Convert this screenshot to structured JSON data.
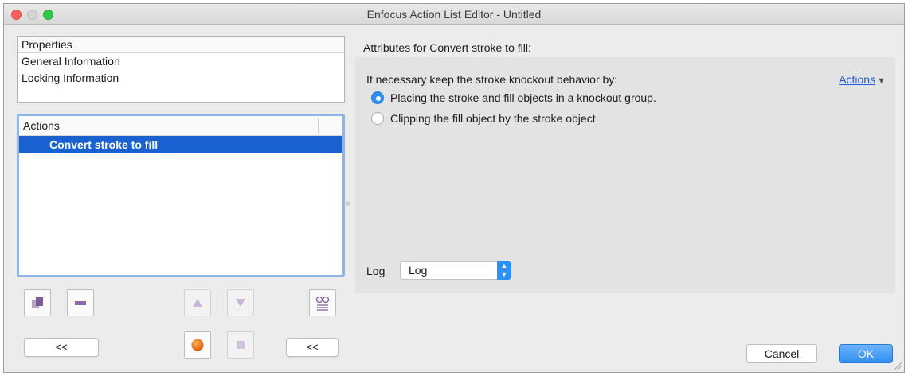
{
  "window": {
    "title": "Enfocus Action List Editor - Untitled"
  },
  "properties": {
    "header": "Properties",
    "items": [
      "General Information",
      "Locking Information"
    ]
  },
  "actions_list": {
    "header": "Actions",
    "items": [
      {
        "label": "Convert stroke to fill",
        "selected": true
      }
    ]
  },
  "toolbar": {
    "add_icon": "add-action-icon",
    "remove_icon": "remove-action-icon",
    "move_up_icon": "arrow-up-icon",
    "move_down_icon": "arrow-down-icon",
    "preview_icon": "glasses-icon",
    "record_icon": "record-icon",
    "stop_icon": "stop-icon",
    "collapse_left_label": "<<",
    "collapse_right_label": "<<"
  },
  "attributes": {
    "title": "Attributes for Convert stroke to fill:",
    "keep_label": "If necessary keep the stroke knockout behavior by:",
    "actions_link": "Actions",
    "options": [
      {
        "label": "Placing the stroke and fill objects in a knockout group.",
        "selected": true
      },
      {
        "label": "Clipping the fill object by the stroke object.",
        "selected": false
      }
    ],
    "log_label": "Log",
    "log_value": "Log"
  },
  "footer": {
    "cancel_label": "Cancel",
    "ok_label": "OK"
  },
  "colors": {
    "accent": "#2f8ff3",
    "selection": "#1961d1",
    "link": "#1b5fd1",
    "record": "#f06a00"
  }
}
